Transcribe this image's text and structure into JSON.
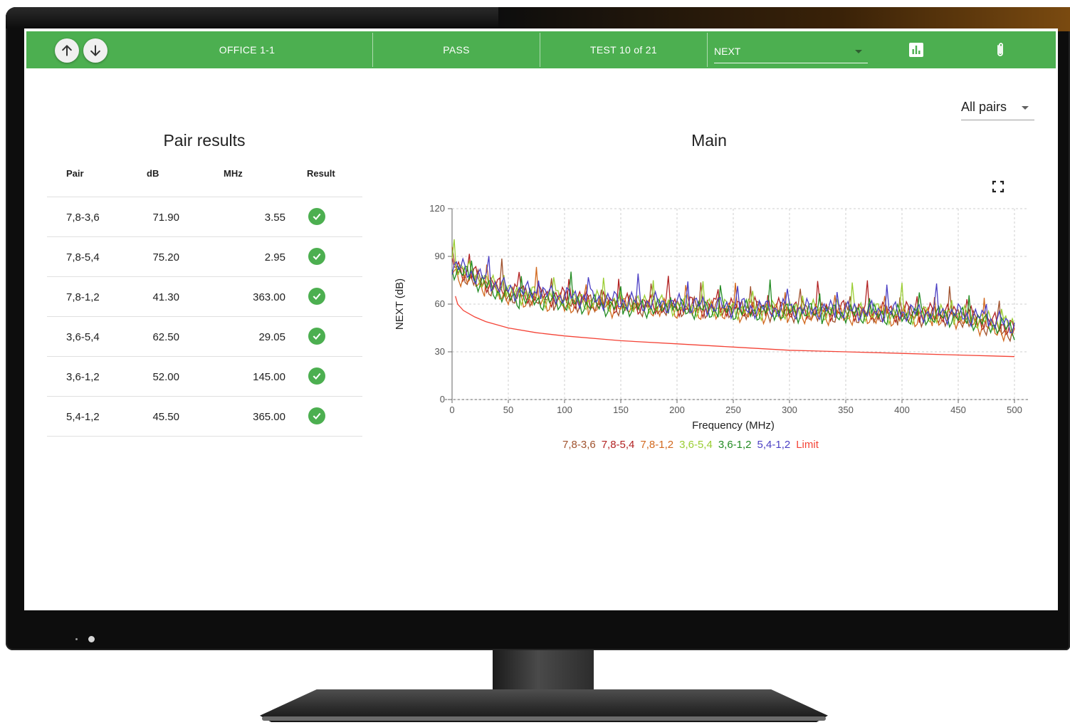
{
  "toolbar": {
    "location": "OFFICE 1-1",
    "status": "PASS",
    "test_counter": "TEST 10 of 21",
    "measurement_select": "NEXT",
    "icons": [
      "arrow-up-icon",
      "arrow-down-icon",
      "bar-chart-icon",
      "paperclip-icon"
    ],
    "color": "#4caf50"
  },
  "pair_filter": {
    "selected": "All pairs"
  },
  "pair_results": {
    "title": "Pair results",
    "columns": [
      "Pair",
      "dB",
      "MHz",
      "Result"
    ],
    "rows": [
      {
        "pair": "7,8-3,6",
        "db": "71.90",
        "mhz": "3.55",
        "result": "pass"
      },
      {
        "pair": "7,8-5,4",
        "db": "75.20",
        "mhz": "2.95",
        "result": "pass"
      },
      {
        "pair": "7,8-1,2",
        "db": "41.30",
        "mhz": "363.00",
        "result": "pass"
      },
      {
        "pair": "3,6-5,4",
        "db": "62.50",
        "mhz": "29.05",
        "result": "pass"
      },
      {
        "pair": "3,6-1,2",
        "db": "52.00",
        "mhz": "145.00",
        "result": "pass"
      },
      {
        "pair": "5,4-1,2",
        "db": "45.50",
        "mhz": "365.00",
        "result": "pass"
      }
    ]
  },
  "chart_data": {
    "type": "line",
    "title": "Main",
    "xlabel": "Frequency (MHz)",
    "ylabel": "NEXT (dB)",
    "xlim": [
      0,
      500
    ],
    "ylim": [
      0,
      120
    ],
    "xticks": [
      "0",
      "50",
      "100",
      "150",
      "200",
      "250",
      "300",
      "350",
      "400",
      "450",
      "500"
    ],
    "yticks": [
      "0",
      "30",
      "60",
      "90",
      "120"
    ],
    "grid": true,
    "legend_position": "bottom",
    "series": [
      {
        "name": "7,8-3,6",
        "color": "#a0522d",
        "x": [
          0,
          50,
          100,
          150,
          200,
          250,
          300,
          350,
          400,
          450,
          500
        ],
        "y": [
          82,
          66,
          62,
          59,
          58,
          57,
          55,
          54,
          53,
          52,
          42
        ]
      },
      {
        "name": "7,8-5,4",
        "color": "#b22222",
        "x": [
          0,
          50,
          100,
          150,
          200,
          250,
          300,
          350,
          400,
          450,
          500
        ],
        "y": [
          84,
          68,
          64,
          60,
          59,
          58,
          57,
          56,
          55,
          54,
          45
        ]
      },
      {
        "name": "7,8-1,2",
        "color": "#d2691e",
        "x": [
          0,
          50,
          100,
          150,
          200,
          250,
          300,
          350,
          400,
          450,
          500
        ],
        "y": [
          80,
          65,
          60,
          58,
          57,
          55,
          54,
          53,
          52,
          51,
          41
        ]
      },
      {
        "name": "3,6-5,4",
        "color": "#9acd32",
        "x": [
          0,
          50,
          100,
          150,
          200,
          250,
          300,
          350,
          400,
          450,
          500
        ],
        "y": [
          86,
          67,
          63,
          61,
          59,
          57,
          56,
          56,
          54,
          53,
          46
        ]
      },
      {
        "name": "3,6-1,2",
        "color": "#228b22",
        "x": [
          0,
          50,
          100,
          150,
          200,
          250,
          300,
          350,
          400,
          450,
          500
        ],
        "y": [
          83,
          64,
          61,
          58,
          57,
          56,
          55,
          54,
          53,
          52,
          44
        ]
      },
      {
        "name": "5,4-1,2",
        "color": "#4b3fc4",
        "x": [
          0,
          50,
          100,
          150,
          200,
          250,
          300,
          350,
          400,
          450,
          500
        ],
        "y": [
          85,
          69,
          65,
          62,
          60,
          58,
          57,
          56,
          55,
          54,
          47
        ]
      },
      {
        "name": "Limit",
        "color": "#f44336",
        "x": [
          3,
          5,
          10,
          20,
          30,
          50,
          75,
          100,
          150,
          200,
          250,
          300,
          350,
          400,
          450,
          500
        ],
        "y": [
          65,
          60,
          56,
          52,
          49,
          45,
          42,
          40,
          37,
          35,
          33,
          31,
          30,
          29,
          28,
          27
        ]
      }
    ]
  }
}
